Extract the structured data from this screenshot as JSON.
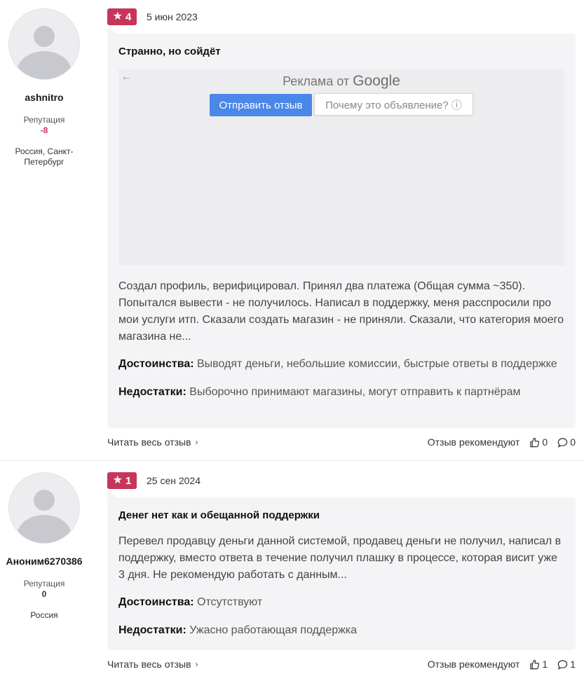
{
  "reviews": [
    {
      "author": {
        "name": "ashnitro",
        "reputation_label": "Репутация",
        "reputation": "-8",
        "location": "Россия, Санкт-Петербург"
      },
      "rating": "4",
      "date": "5 июн 2023",
      "title": "Странно, но сойдёт",
      "ad": {
        "back": "←",
        "title_prefix": "Реклама от",
        "title_brand": "Google",
        "send_feedback": "Отправить отзыв",
        "why_this_ad": "Почему это объявление? ⓘ"
      },
      "text": "Создал профиль, верифицировал. Принял два платежа (Общая сумма ~350). Попытался вывести - не получилось. Написал в поддержку, меня расспросили про мои услуги итп. Сказали создать магазин - не приняли. Сказали, что категория моего магазина не...",
      "pros_label": "Достоинства:",
      "pros": "Выводят деньги, небольшие комиссии, быстрые ответы в поддержке",
      "cons_label": "Недостатки:",
      "cons": "Выборочно принимают магазины, могут отправить к партнёрам",
      "read_more": "Читать весь отзыв",
      "recommend_label": "Отзыв рекомендуют",
      "likes": "0",
      "comments": "0"
    },
    {
      "author": {
        "name": "Аноним6270386",
        "reputation_label": "Репутация",
        "reputation": "0",
        "location": "Россия"
      },
      "rating": "1",
      "date": "25 сен 2024",
      "title": "Денег нет как и обещанной поддержки",
      "text": "Перевел продавцу деньги данной системой, продавец деньги не получил, написал в поддержку, вместо ответа в течение получил плашку в процессе, которая висит уже 3 дня. Не рекомендую работать с данным...",
      "pros_label": "Достоинства:",
      "pros": "Отсутствуют",
      "cons_label": "Недостатки:",
      "cons": "Ужасно работающая поддержка",
      "read_more": "Читать весь отзыв",
      "recommend_label": "Отзыв рекомендуют",
      "likes": "1",
      "comments": "1"
    }
  ],
  "colors": {
    "accent": "#c7355a",
    "card_bg": "#f4f4f6",
    "ad_button": "#4a87e8"
  }
}
